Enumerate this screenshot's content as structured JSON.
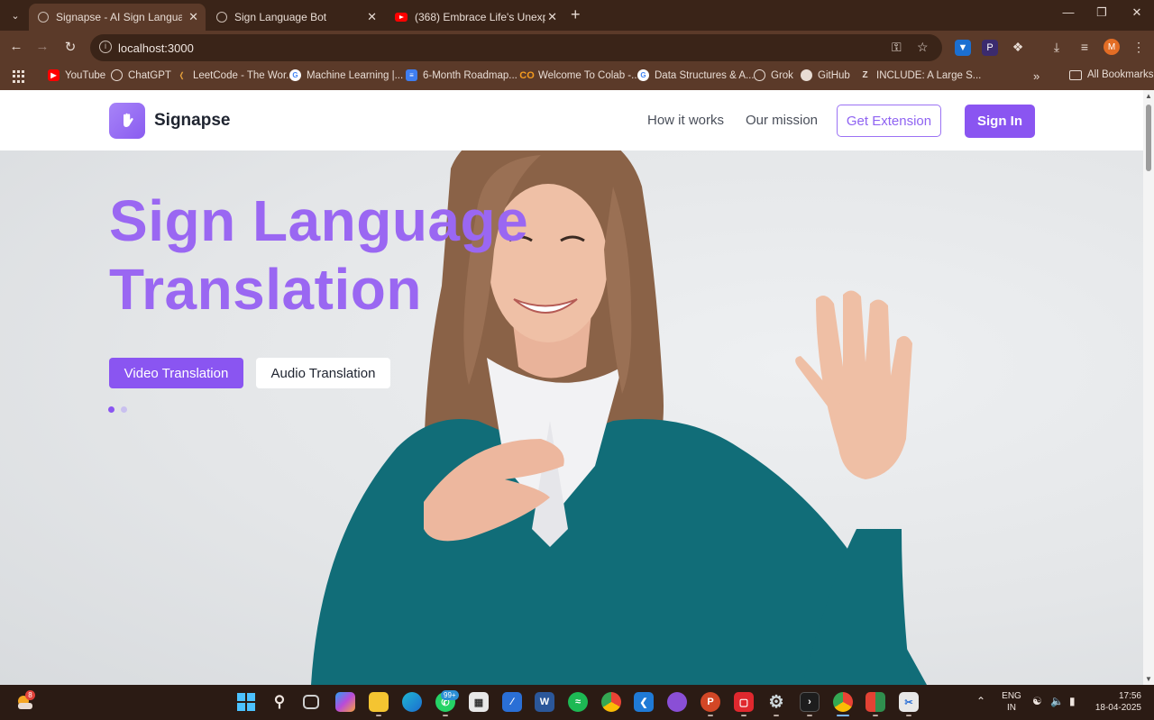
{
  "browser": {
    "tabs": [
      {
        "title": "Signapse - AI Sign Language Tr",
        "active": true
      },
      {
        "title": "Sign Language Bot",
        "active": false
      },
      {
        "title": "(368) Embrace Life's Unexpecte",
        "active": false
      }
    ],
    "url": "localhost:3000",
    "profile_initial": "M",
    "bookmarks": [
      {
        "label": "YouTube",
        "icon": "youtube-icon",
        "color": "#ff0000"
      },
      {
        "label": "ChatGPT",
        "icon": "chatgpt-icon",
        "color": "#6d6d6d"
      },
      {
        "label": "LeetCode - The Wor...",
        "icon": "leetcode-icon",
        "color": "#e7a13b"
      },
      {
        "label": "Machine Learning |...",
        "icon": "google-icon",
        "color": "#ffffff"
      },
      {
        "label": "6-Month Roadmap...",
        "icon": "docs-icon",
        "color": "#3f7ef0"
      },
      {
        "label": "Welcome To Colab -...",
        "icon": "colab-icon",
        "color": "#f49b1f"
      },
      {
        "label": "Data Structures & A...",
        "icon": "google-icon",
        "color": "#ffffff"
      },
      {
        "label": "Grok",
        "icon": "grok-icon",
        "color": "#e8dcd4"
      },
      {
        "label": "GitHub",
        "icon": "github-icon",
        "color": "#e8dcd4"
      },
      {
        "label": "INCLUDE: A Large S...",
        "icon": "zotero-icon",
        "color": "#e8dcd4"
      }
    ],
    "all_bookmarks_label": "All Bookmarks"
  },
  "site": {
    "brand": "Signapse",
    "nav": {
      "how_it_works": "How it works",
      "our_mission": "Our mission",
      "get_extension": "Get Extension",
      "sign_in": "Sign In"
    },
    "hero": {
      "title_line1": "Sign Language",
      "title_line2": "Translation",
      "video_button": "Video Translation",
      "audio_button": "Audio Translation",
      "carousel_active_index": 0,
      "carousel_count": 2
    },
    "colors": {
      "accent": "#8a55f1",
      "title": "#9a67f2"
    }
  },
  "taskbar": {
    "weather_badge": "8",
    "whatsapp_badge": "99+",
    "language": "ENG",
    "region": "IN",
    "time": "17:56",
    "date": "18-04-2025"
  }
}
